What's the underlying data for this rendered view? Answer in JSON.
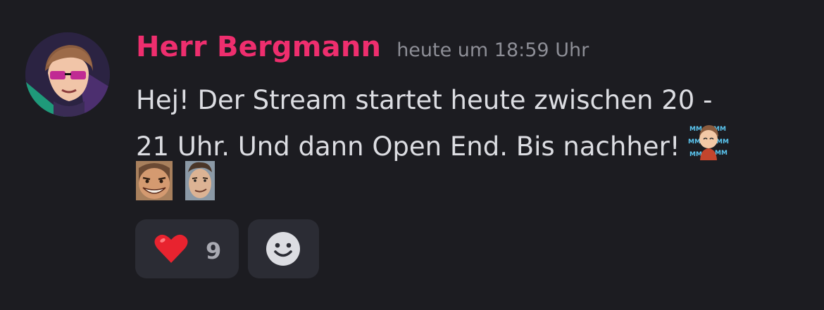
{
  "message": {
    "author": "Herr Bergmann",
    "timestamp": "heute um 18:59 Uhr",
    "text_line_1": "Hej! Der Stream startet heute zwischen 20 -",
    "text_line_2": "21 Uhr. Und dann Open End. Bis nachher!",
    "inline_emoji": "mmm-emote",
    "emojis": [
      "grinning-face-emote",
      "smirking-face-emote"
    ]
  },
  "reactions": [
    {
      "emoji": "❤️",
      "icon": "heart-icon",
      "count": "9"
    }
  ],
  "add_reaction": {
    "icon": "add-reaction-smiley-icon"
  },
  "colors": {
    "background": "#1c1c21",
    "username": "#ee2e6e",
    "text": "#dcdde2",
    "timestamp": "#8d8e96",
    "reaction_bg": "#2b2c34",
    "heart": "#e8232f"
  }
}
